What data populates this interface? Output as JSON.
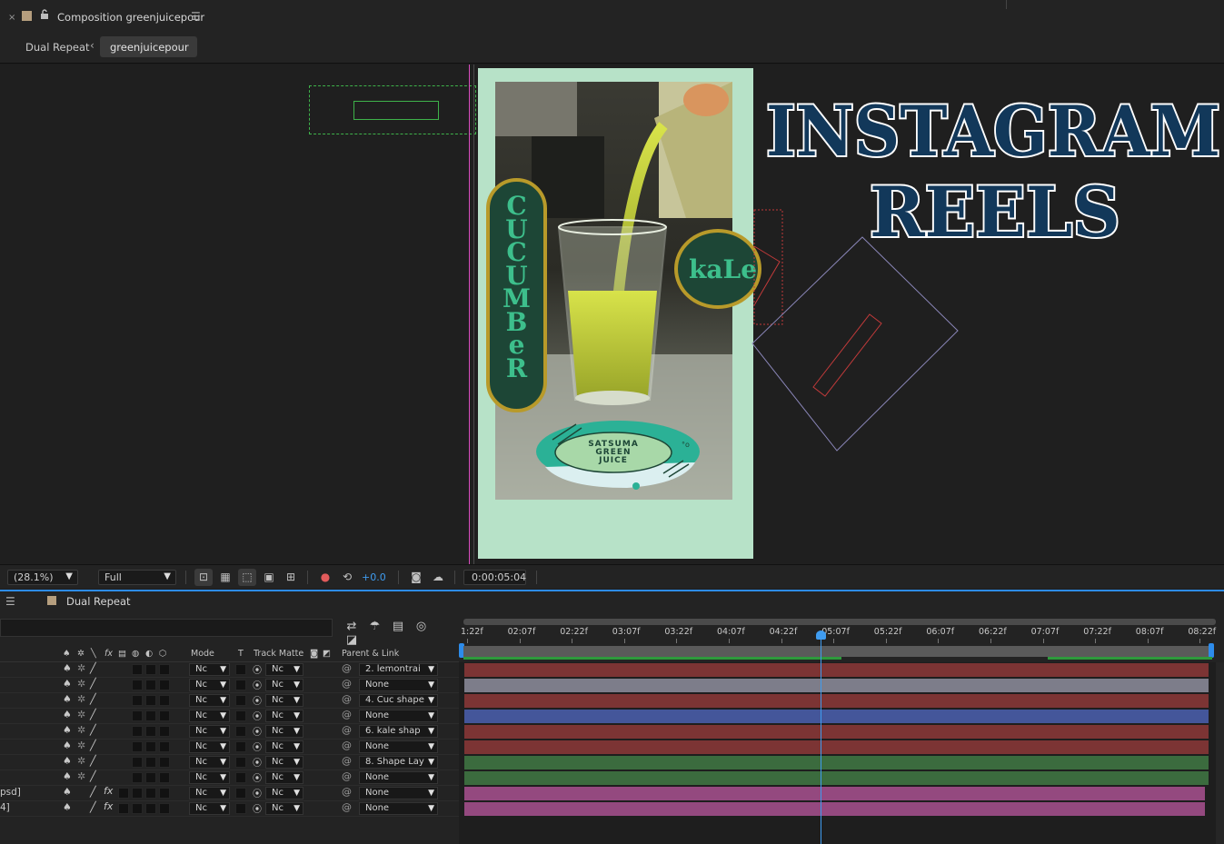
{
  "panel": {
    "close_glyph": "×",
    "title": "Composition greenjuicepour",
    "menu_glyph": "☰"
  },
  "breadcrumb": {
    "parent": "Dual Repeat",
    "current": "greenjuicepour"
  },
  "artwork": {
    "pill_text": [
      "C",
      "U",
      "C",
      "U",
      "M",
      "B",
      "e",
      "R"
    ],
    "kale_text": "kaLe",
    "badge_text": [
      "SATSUMA",
      "GREEN",
      "JUICE"
    ],
    "headline_1": "INSTAGRAM",
    "headline_2": "REELS",
    "colors": {
      "frame": "#b7e2c8",
      "pill_fill": "#1d4636",
      "pill_border": "#b89a2a",
      "pill_text": "#3dbf8c",
      "headline": "#12385a",
      "badge_teal": "#2bb196"
    }
  },
  "viewer_toolbar": {
    "zoom": "(28.1%)",
    "resolution": "Full",
    "exposure": "+0.0",
    "timecode": "0:00:05:04"
  },
  "timeline": {
    "title": "Dual Repeat",
    "columns": {
      "mode": "Mode",
      "t": "T",
      "track_matte": "Track Matte",
      "parent_link": "Parent & Link"
    },
    "ruler_labels": [
      "1:22f",
      "02:07f",
      "02:22f",
      "03:07f",
      "03:22f",
      "04:07f",
      "04:22f",
      "05:07f",
      "05:22f",
      "06:07f",
      "06:22f",
      "07:07f",
      "07:22f",
      "08:07f",
      "08:22f"
    ],
    "layers": [
      {
        "source": "",
        "mode": "Nc",
        "matte": "Nc",
        "parent": "2. lemontrai",
        "fx": false,
        "color": "#7c3434"
      },
      {
        "source": "",
        "mode": "Nc",
        "matte": "Nc",
        "parent": "None",
        "fx": false,
        "color": "#7d7d8a"
      },
      {
        "source": "",
        "mode": "Nc",
        "matte": "Nc",
        "parent": "4. Cuc shape",
        "fx": false,
        "color": "#7c3434"
      },
      {
        "source": "",
        "mode": "Nc",
        "matte": "Nc",
        "parent": "None",
        "fx": false,
        "color": "#44569a"
      },
      {
        "source": "",
        "mode": "Nc",
        "matte": "Nc",
        "parent": "6. kale shap",
        "fx": false,
        "color": "#7c3434"
      },
      {
        "source": "",
        "mode": "Nc",
        "matte": "Nc",
        "parent": "None",
        "fx": false,
        "color": "#7c3434"
      },
      {
        "source": "",
        "mode": "Nc",
        "matte": "Nc",
        "parent": "8. Shape Lay",
        "fx": false,
        "color": "#3b6b3e"
      },
      {
        "source": "",
        "mode": "Nc",
        "matte": "Nc",
        "parent": "None",
        "fx": false,
        "color": "#3b6b3e"
      },
      {
        "source": "psd]",
        "mode": "Nc",
        "matte": "Nc",
        "parent": "None",
        "fx": true,
        "color": "#94497f"
      },
      {
        "source": "4]",
        "mode": "Nc",
        "matte": "Nc",
        "parent": "None",
        "fx": true,
        "color": "#94497f"
      }
    ]
  }
}
